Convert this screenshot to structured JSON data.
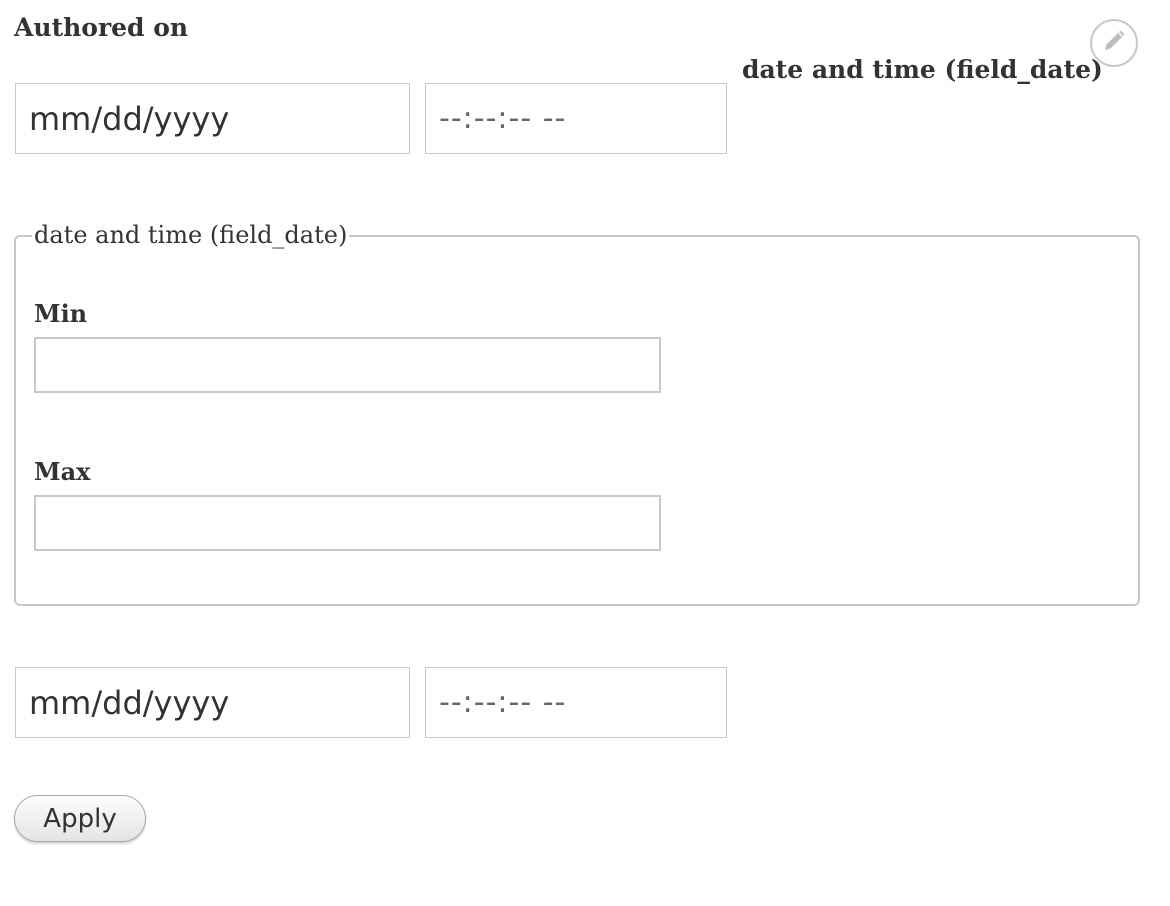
{
  "authored_on": {
    "label": "Authored on",
    "date_placeholder": "mm/dd/yyyy",
    "time_placeholder": "--:--:-- --"
  },
  "field_date": {
    "title": "date and time (field_date)",
    "legend": "date and time (field_date)",
    "min_label": "Min",
    "min_value": "",
    "max_label": "Max",
    "max_value": "",
    "date_placeholder": "mm/dd/yyyy",
    "time_placeholder": "--:--:-- --"
  },
  "actions": {
    "apply_label": "Apply"
  },
  "icons": {
    "edit": "pencil-icon"
  },
  "colors": {
    "text": "#333333",
    "border": "#c8c8c8",
    "button_bg": "#eeeeee"
  }
}
